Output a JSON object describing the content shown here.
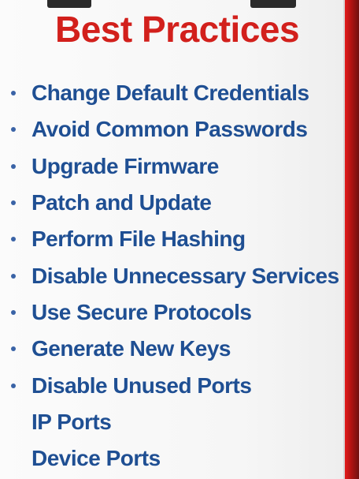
{
  "title": "Best Practices",
  "items": [
    {
      "text": "Change Default Credentials",
      "bullet": true
    },
    {
      "text": "Avoid Common Passwords",
      "bullet": true
    },
    {
      "text": "Upgrade Firmware",
      "bullet": true
    },
    {
      "text": "Patch and Update",
      "bullet": true
    },
    {
      "text": "Perform File Hashing",
      "bullet": true
    },
    {
      "text": "Disable Unnecessary Services",
      "bullet": true
    },
    {
      "text": "Use Secure Protocols",
      "bullet": true
    },
    {
      "text": "Generate New Keys",
      "bullet": true
    },
    {
      "text": "Disable Unused Ports",
      "bullet": true
    },
    {
      "text": "IP Ports",
      "bullet": false
    },
    {
      "text": "Device Ports",
      "bullet": false
    }
  ],
  "colors": {
    "title": "#d2201c",
    "text": "#1f4f93",
    "accent_edge": "#c51717"
  }
}
